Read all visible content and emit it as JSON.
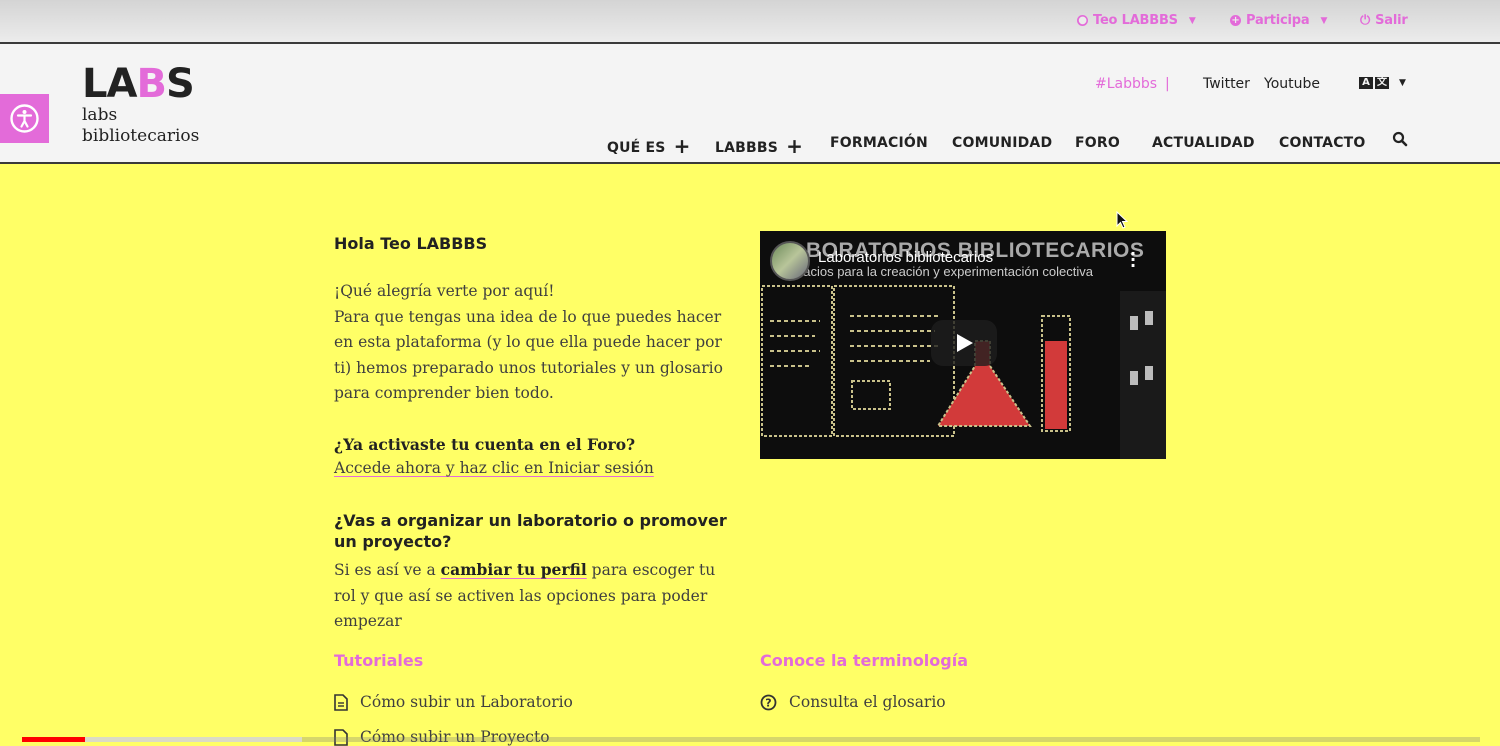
{
  "topbar": {
    "user_label": "Teo LABBBS",
    "participa_label": "Participa",
    "salir_label": "Salir"
  },
  "header": {
    "logo_text_la": "LA",
    "logo_text_bb": "B",
    "logo_text_s": "S",
    "logo_sub_line1": "labs",
    "logo_sub_line2": "bibliotecarios",
    "hashtag": "#Labbbs",
    "separator": "|",
    "twitter": "Twitter",
    "youtube": "Youtube",
    "lang_a": "A",
    "lang_b": "文"
  },
  "nav": {
    "que_es": "QUÉ ES",
    "labbbs": "LABBBS",
    "formacion": "FORMACIÓN",
    "comunidad": "COMUNIDAD",
    "foro": "FORO",
    "actualidad": "ACTUALIDAD",
    "contacto": "CONTACTO"
  },
  "main": {
    "greeting": "Hola Teo LABBBS",
    "intro_line": "¡Qué alegría verte por aquí!",
    "intro_body": "Para que tengas una idea de lo que puedes hacer en esta plataforma (y lo que ella puede hacer por ti) hemos preparado unos tutoriales y un glosario para comprender bien todo.",
    "foro_question": "¿Ya activaste tu cuenta en el Foro?",
    "foro_link": "Accede ahora y haz clic en Iniciar sesión",
    "org_question": "¿Vas a organizar un laboratorio o promover un proyecto?",
    "org_prefix": "Si es así ve a",
    "org_link": "cambiar tu perfil",
    "org_suffix": "para escoger tu rol y que así se activen las opciones para poder empezar",
    "tutoriales_heading": "Tutoriales",
    "tutorial_1": "Cómo subir un Laboratorio",
    "tutorial_2": "Cómo subir un Proyecto",
    "terminologia_heading": "Conoce la terminología",
    "glosario_link": "Consulta el glosario"
  },
  "video": {
    "title": "Laboratorios bibliotecarios",
    "big_title": "BORATORIOS BIBLIOTECARIOS",
    "subtitle": "pacios para la creación y experimentación colectiva"
  },
  "playback": {
    "played_fraction": 0.043
  },
  "colors": {
    "accent": "#e36bd9",
    "background": "#ffff66"
  }
}
